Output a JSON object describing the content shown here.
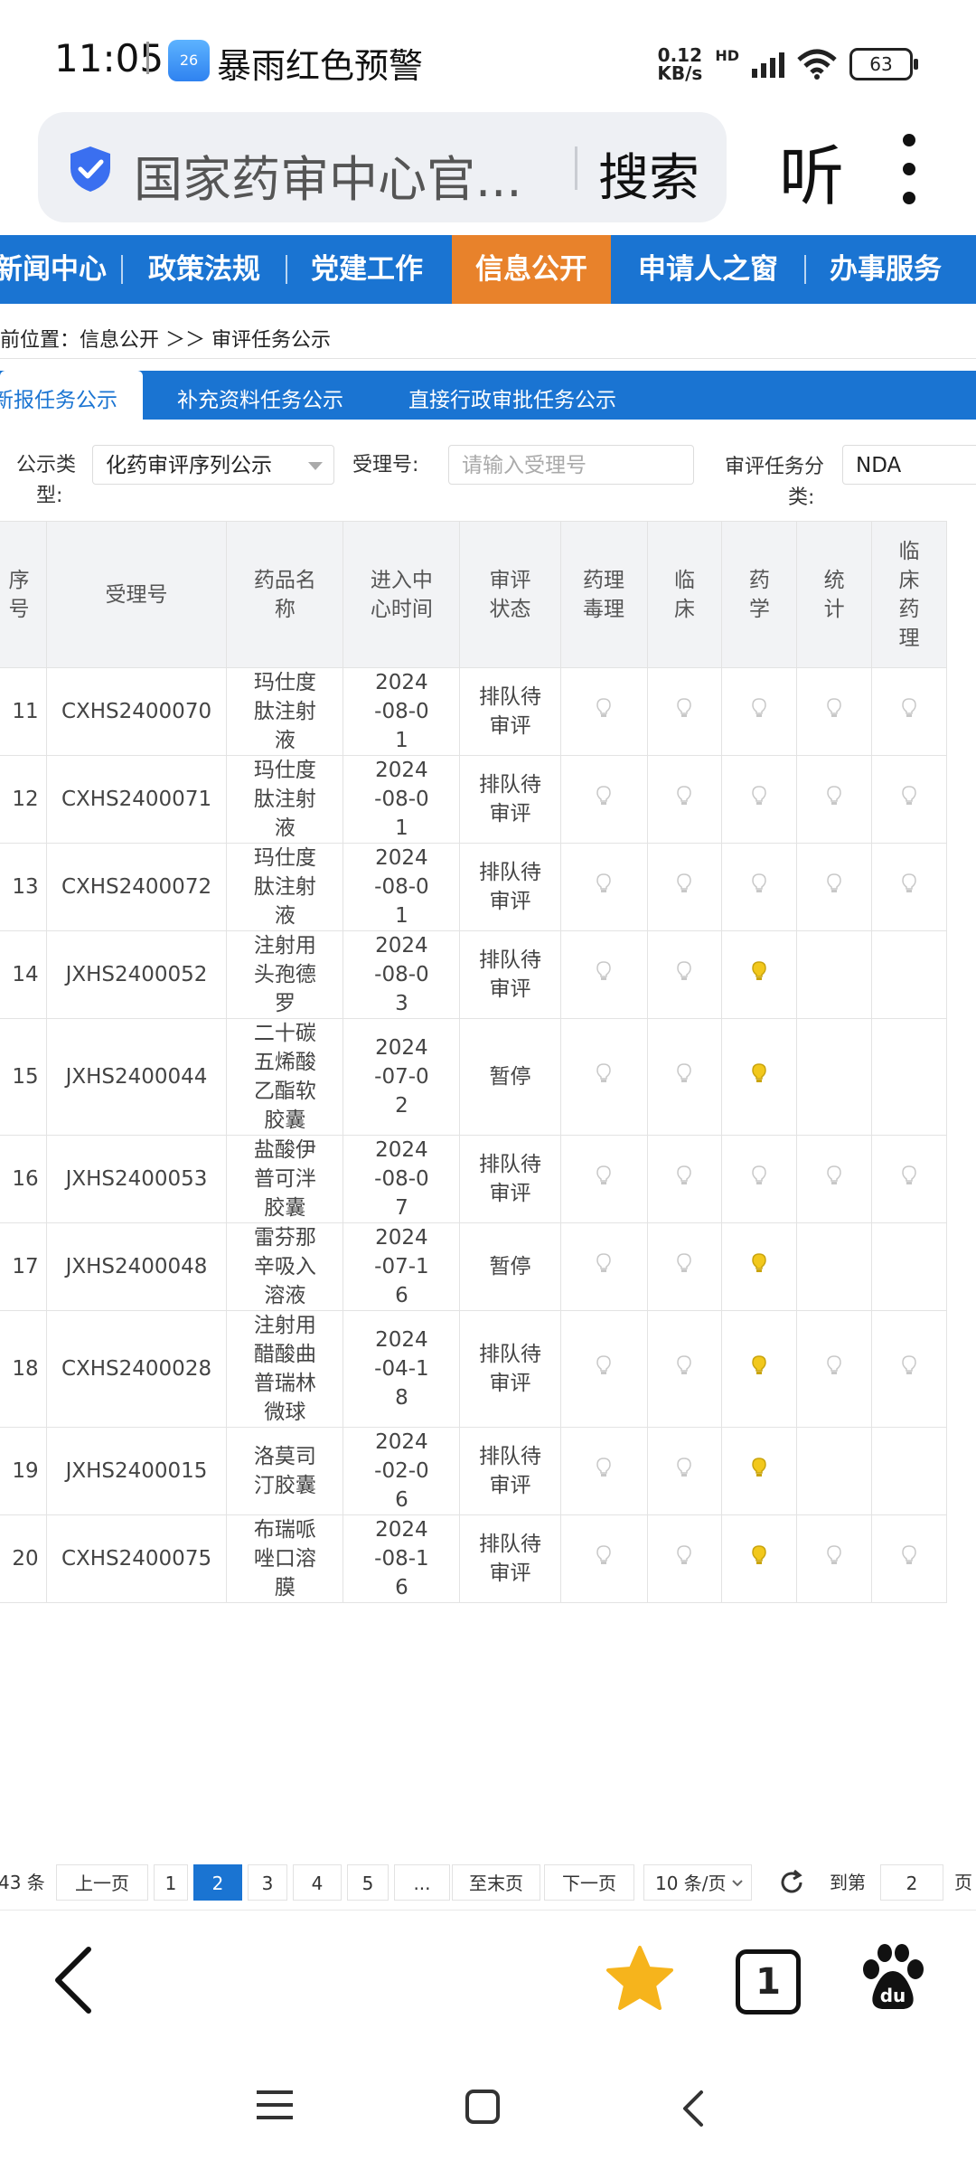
{
  "status_bar": {
    "time": "11:05",
    "app_icon_text": "26",
    "alert": "暴雨红色预警",
    "net_speed_top": "0.12",
    "net_speed_bottom": "KB/s",
    "hd": "HD",
    "battery": "63"
  },
  "browser": {
    "url_text": "国家药审中心官...",
    "search_label": "搜索",
    "listen_label": "听"
  },
  "site_nav": {
    "items": [
      "新闻中心",
      "政策法规",
      "党建工作",
      "信息公开",
      "申请人之窗",
      "办事服务"
    ],
    "active": "信息公开"
  },
  "breadcrumb": "前位置：信息公开 ＞＞ 审评任务公示",
  "tabs": [
    "新报任务公示",
    "补充资料任务公示",
    "直接行政审批任务公示"
  ],
  "filters": {
    "type_label_1": "公示类",
    "type_label_2": "型:",
    "type_value": "化药审评序列公示",
    "accept_label": "受理号:",
    "accept_placeholder": "请输入受理号",
    "category_label_1": "审评任务分",
    "category_label_2": "类:",
    "category_value": "NDA"
  },
  "table": {
    "headers": {
      "seq": "序号",
      "accept_no": "受理号",
      "drug": "药品名称",
      "date": "进入中心时间",
      "status": "审评状态",
      "pharm_tox": "药理毒理",
      "clinical": "临床",
      "pharmacy": "药学",
      "stats": "统计",
      "clin_pharm": "临床药理"
    },
    "rows": [
      {
        "seq": "11",
        "accept_no": "CXHS2400070",
        "drug": "玛仕度肽注射液",
        "date": "2024-08-01",
        "status": "排队待审评",
        "bulbs": [
          "off",
          "off",
          "off",
          "off",
          "off"
        ]
      },
      {
        "seq": "12",
        "accept_no": "CXHS2400071",
        "drug": "玛仕度肽注射液",
        "date": "2024-08-01",
        "status": "排队待审评",
        "bulbs": [
          "off",
          "off",
          "off",
          "off",
          "off"
        ]
      },
      {
        "seq": "13",
        "accept_no": "CXHS2400072",
        "drug": "玛仕度肽注射液",
        "date": "2024-08-01",
        "status": "排队待审评",
        "bulbs": [
          "off",
          "off",
          "off",
          "off",
          "off"
        ]
      },
      {
        "seq": "14",
        "accept_no": "JXHS2400052",
        "drug": "注射用头孢德罗",
        "date": "2024-08-03",
        "status": "排队待审评",
        "bulbs": [
          "off",
          "off",
          "on",
          "",
          ""
        ]
      },
      {
        "seq": "15",
        "accept_no": "JXHS2400044",
        "drug": "二十碳五烯酸乙酯软胶囊",
        "date": "2024-07-02",
        "status": "暂停",
        "bulbs": [
          "off",
          "off",
          "on",
          "",
          ""
        ]
      },
      {
        "seq": "16",
        "accept_no": "JXHS2400053",
        "drug": "盐酸伊普可泮胶囊",
        "date": "2024-08-07",
        "status": "排队待审评",
        "bulbs": [
          "off",
          "off",
          "off",
          "off",
          "off"
        ]
      },
      {
        "seq": "17",
        "accept_no": "JXHS2400048",
        "drug": "雷芬那辛吸入溶液",
        "date": "2024-07-16",
        "status": "暂停",
        "bulbs": [
          "off",
          "off",
          "on",
          "",
          ""
        ]
      },
      {
        "seq": "18",
        "accept_no": "CXHS2400028",
        "drug": "注射用醋酸曲普瑞林微球",
        "date": "2024-04-18",
        "status": "排队待审评",
        "bulbs": [
          "off",
          "off",
          "on",
          "off",
          "off"
        ]
      },
      {
        "seq": "19",
        "accept_no": "JXHS2400015",
        "drug": "洛莫司汀胶囊",
        "date": "2024-02-06",
        "status": "排队待审评",
        "bulbs": [
          "off",
          "off",
          "on",
          "",
          ""
        ]
      },
      {
        "seq": "20",
        "accept_no": "CXHS2400075",
        "drug": "布瑞哌唑口溶膜",
        "date": "2024-08-16",
        "status": "排队待审评",
        "bulbs": [
          "off",
          "off",
          "on",
          "off",
          "off"
        ]
      }
    ]
  },
  "pagination": {
    "total": "43 条",
    "prev": "上一页",
    "pages": [
      "1",
      "2",
      "3",
      "4",
      "5"
    ],
    "current": "2",
    "ellipsis": "...",
    "last": "至末页",
    "next": "下一页",
    "page_size": "10 条/页",
    "goto_label": "到第",
    "goto_value": "2",
    "goto_suffix": "页"
  },
  "colors": {
    "brand_blue": "#1a74d2",
    "active_orange": "#e8822b",
    "bulb_on": "#f2c81c",
    "bulb_off": "#c8c8c8"
  }
}
